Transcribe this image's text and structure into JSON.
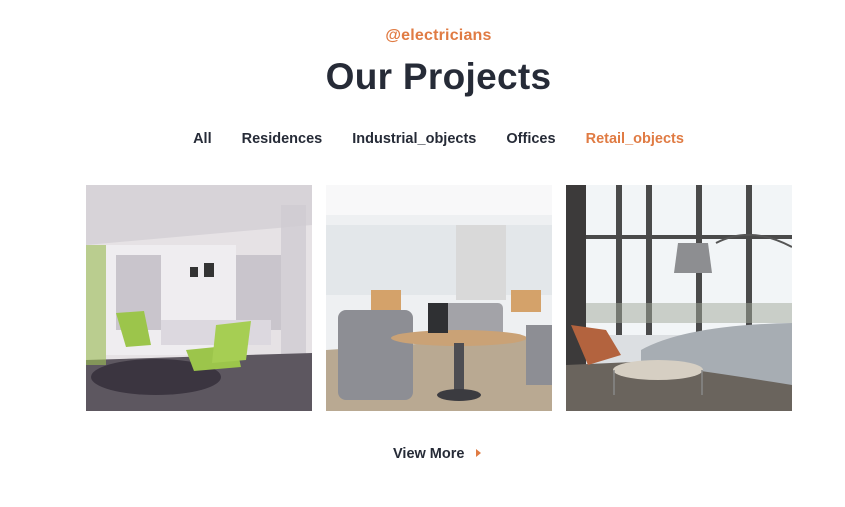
{
  "section": {
    "subtitle": "@electricians",
    "title": "Our Projects"
  },
  "filters": [
    {
      "label": "All",
      "active": false
    },
    {
      "label": "Residences",
      "active": false
    },
    {
      "label": "Industrial_objects",
      "active": false
    },
    {
      "label": "Offices",
      "active": false
    },
    {
      "label": "Retail_objects",
      "active": true
    }
  ],
  "view_more": {
    "label": "View More",
    "icon": "caret-right-icon"
  },
  "colors": {
    "accent": "#e07b43",
    "text": "#262b37"
  }
}
